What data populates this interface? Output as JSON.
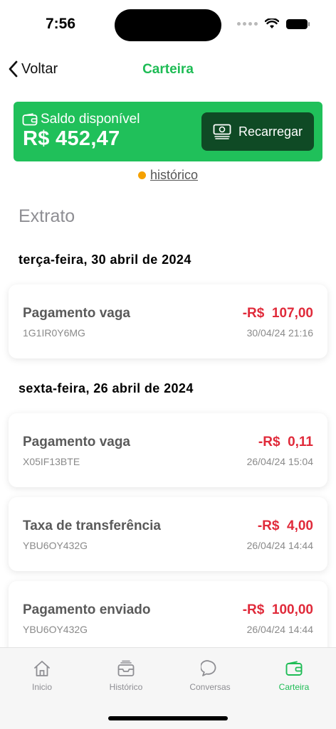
{
  "status": {
    "time": "7:56"
  },
  "nav": {
    "back_label": "Voltar",
    "title": "Carteira"
  },
  "balance": {
    "label": "Saldo disponível",
    "value": "R$ 452,47",
    "recharge_label": "Recarregar"
  },
  "history_link": "histórico",
  "statement_title": "Extrato",
  "groups": [
    {
      "date": "terça-feira, 30 abril de 2024",
      "items": [
        {
          "title": "Pagamento vaga",
          "code": "1G1IR0Y6MG",
          "amount": "-R$  107,00",
          "datetime": "30/04/24 21:16"
        }
      ]
    },
    {
      "date": "sexta-feira, 26 abril de 2024",
      "items": [
        {
          "title": "Pagamento vaga",
          "code": "X05IF13BTE",
          "amount": "-R$  0,11",
          "datetime": "26/04/24 15:04"
        },
        {
          "title": "Taxa de transferência",
          "code": "YBU6OY432G",
          "amount": "-R$  4,00",
          "datetime": "26/04/24 14:44"
        },
        {
          "title": "Pagamento enviado",
          "code": "YBU6OY432G",
          "amount": "-R$  100,00",
          "datetime": "26/04/24 14:44"
        }
      ]
    }
  ],
  "tabs": [
    {
      "label": "Inicio",
      "icon": "home-icon"
    },
    {
      "label": "Histórico",
      "icon": "inbox-icon"
    },
    {
      "label": "Conversas",
      "icon": "chat-bubble-icon"
    },
    {
      "label": "Carteira",
      "icon": "wallet-icon"
    }
  ],
  "colors": {
    "accent": "#1ebc55",
    "card": "#20c05a",
    "button": "#0f4a25",
    "negative": "#e02a3a",
    "history_dot": "#f5a100"
  }
}
